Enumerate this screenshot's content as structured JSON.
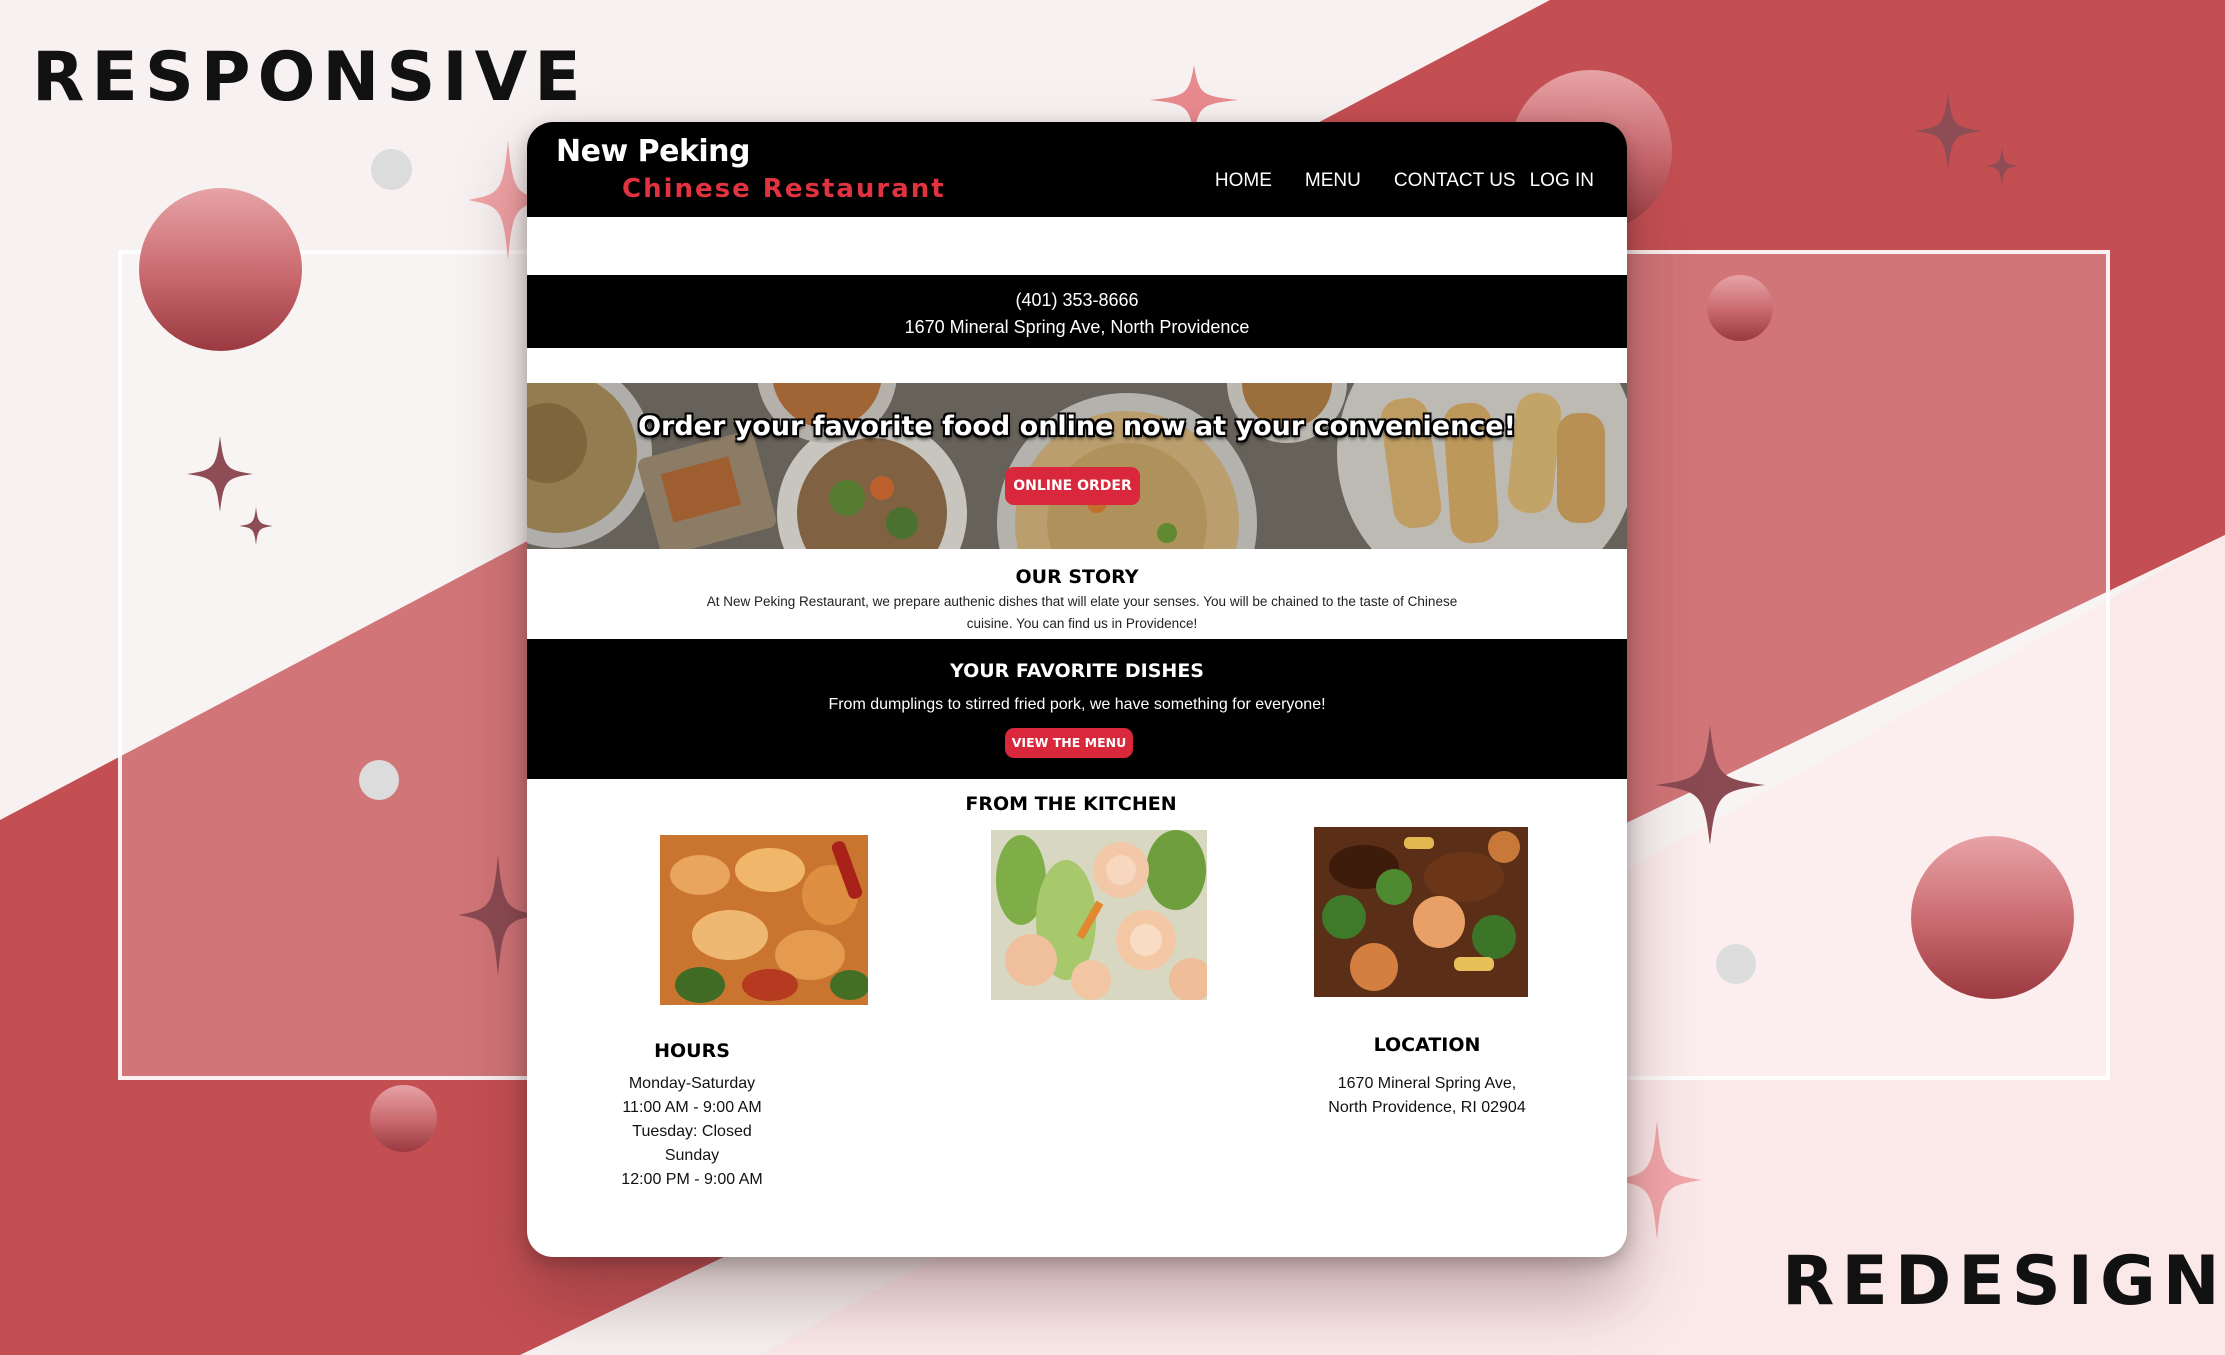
{
  "showcase": {
    "label_top": "RESPONSIVE",
    "label_bottom": "REDESIGN",
    "colors": {
      "accent": "#c44f53",
      "background": "#f7f1f1",
      "brand_red": "#d9283b"
    }
  },
  "site": {
    "logo_line1": "New Peking",
    "logo_line2": "Chinese Restaurant",
    "nav": [
      "HOME",
      "MENU",
      "CONTACT US",
      "LOG IN"
    ],
    "contact": {
      "phone": "(401) 353-8666",
      "address": "1670 Mineral Spring Ave, North Providence"
    },
    "hero": {
      "title": "Order your favorite food online now at your convenience!",
      "button": "ONLINE ORDER"
    },
    "story": {
      "title": "OUR STORY",
      "text": "At New Peking Restaurant, we prepare authenic dishes that will elate your senses. You will be chained to the taste of Chinese cuisine. You can find us in Providence!"
    },
    "favorites": {
      "title": "YOUR FAVORITE DISHES",
      "subtitle": "From dumplings to stirred fried pork, we have something for everyone!",
      "button": "VIEW THE MENU"
    },
    "kitchen": {
      "title": "FROM THE KITCHEN",
      "photos": [
        "spicy-shrimp-photo",
        "shrimp-bok-choy-photo",
        "beef-shrimp-stirfry-photo"
      ]
    },
    "hours": {
      "title": "HOURS",
      "lines": [
        "Monday-Saturday",
        "11:00 AM - 9:00 AM",
        "Tuesday: Closed",
        "Sunday",
        "12:00 PM - 9:00 AM"
      ]
    },
    "location": {
      "title": "LOCATION",
      "lines": [
        "1670 Mineral Spring Ave,",
        "North Providence, RI 02904"
      ]
    }
  }
}
